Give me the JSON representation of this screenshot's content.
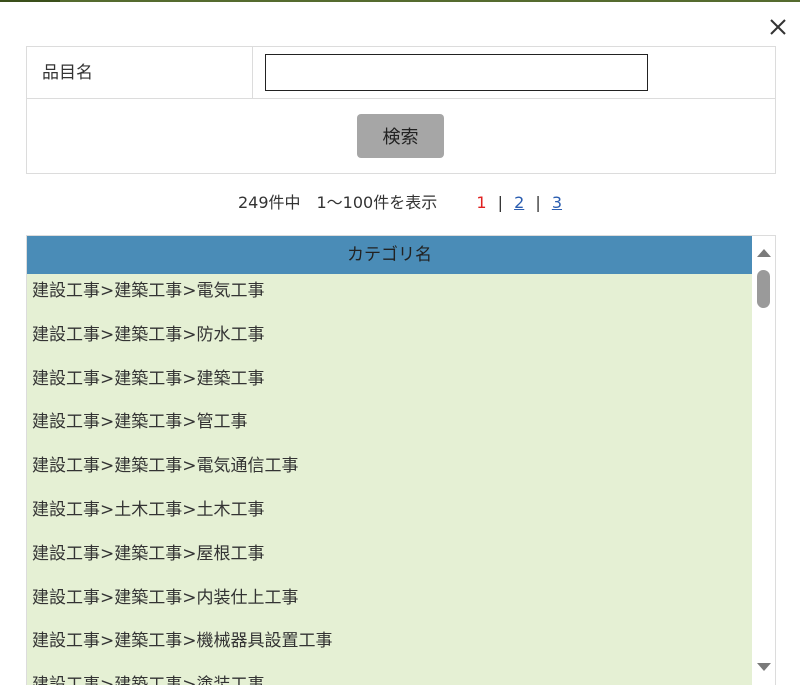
{
  "close": {
    "icon": "close-icon"
  },
  "form": {
    "label": "品目名",
    "input_value": "",
    "input_placeholder": "",
    "search_button": "検索"
  },
  "pager": {
    "count_text": "249件中　1～100件を表示",
    "pages": [
      "1",
      "2",
      "3"
    ],
    "current_page": "1",
    "separator": "|"
  },
  "list": {
    "header": "カテゴリ名",
    "items": [
      "建設工事>建築工事>電気工事",
      "建設工事>建築工事>防水工事",
      "建設工事>建築工事>建築工事",
      "建設工事>建築工事>管工事",
      "建設工事>建築工事>電気通信工事",
      "建設工事>土木工事>土木工事",
      "建設工事>建築工事>屋根工事",
      "建設工事>建築工事>内装仕上工事",
      "建設工事>建築工事>機械器具設置工事",
      "建設工事>建築工事>塗装工事"
    ]
  },
  "colors": {
    "header_bg": "#4a8cb7",
    "list_bg": "#e5f0d4",
    "current_page": "#e02020",
    "link": "#2a5db0",
    "button_bg": "#a6a6a6"
  }
}
